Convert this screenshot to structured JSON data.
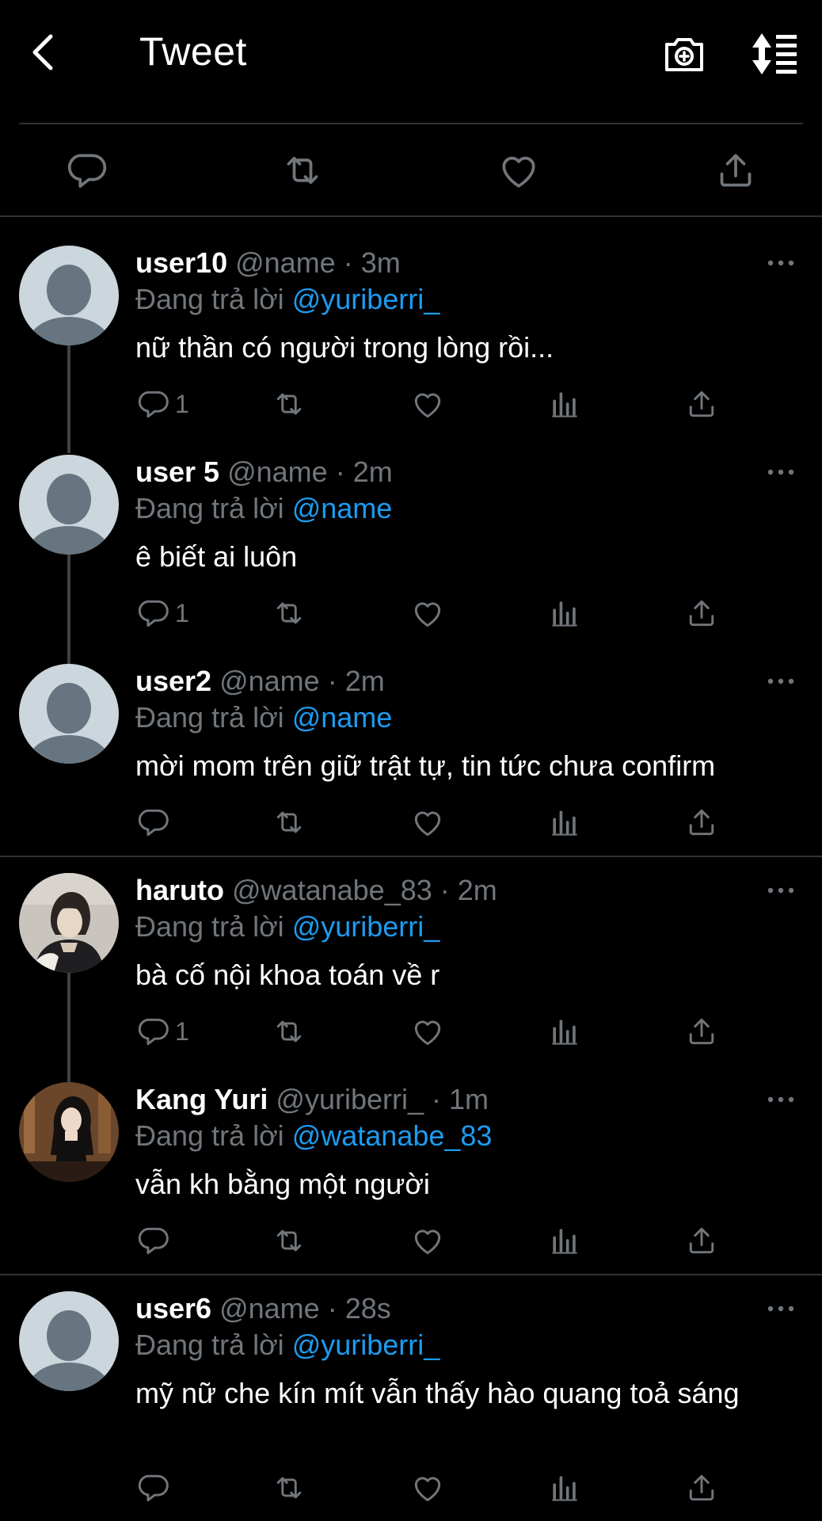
{
  "header": {
    "title": "Tweet"
  },
  "reply_label": "Đang trả lời",
  "tweets": [
    {
      "username": "user10",
      "handle": "@name",
      "time": "· 3m",
      "reply_to": "@yuriberri_",
      "text": "nữ thần có người trong lòng rồi...",
      "reply_count": "1",
      "avatar": "default-avatar"
    },
    {
      "username": "user 5",
      "handle": "@name",
      "time": "· 2m",
      "reply_to": "@name",
      "text": "ê biết ai luôn",
      "reply_count": "1",
      "avatar": "default-avatar"
    },
    {
      "username": "user2",
      "handle": "@name",
      "time": "· 2m",
      "reply_to": "@name",
      "text": "mời mom trên giữ trật tự, tin tức chưa confirm",
      "reply_count": "",
      "avatar": "default-avatar"
    },
    {
      "username": "haruto",
      "handle": "@watanabe_83",
      "time": "· 2m",
      "reply_to": "@yuriberri_",
      "text": "bà cố nội khoa toán về r",
      "reply_count": "1",
      "avatar": "photo-avatar-haruto"
    },
    {
      "username": "Kang Yuri",
      "handle": "@yuriberri_",
      "time": "· 1m",
      "reply_to": "@watanabe_83",
      "text": "vẫn kh bằng một người",
      "reply_count": "",
      "avatar": "photo-avatar-yuri"
    },
    {
      "username": "user6",
      "handle": "@name",
      "time": "· 28s",
      "reply_to": "@yuriberri_",
      "text": "mỹ nữ che kín mít vẫn thấy hào quang toả sáng",
      "reply_count": "",
      "avatar": "default-avatar"
    }
  ],
  "colors": {
    "background": "#000000",
    "text": "#e7e9ea",
    "muted": "#71767b",
    "accent": "#1d9bf0",
    "divider": "#2f3336"
  }
}
